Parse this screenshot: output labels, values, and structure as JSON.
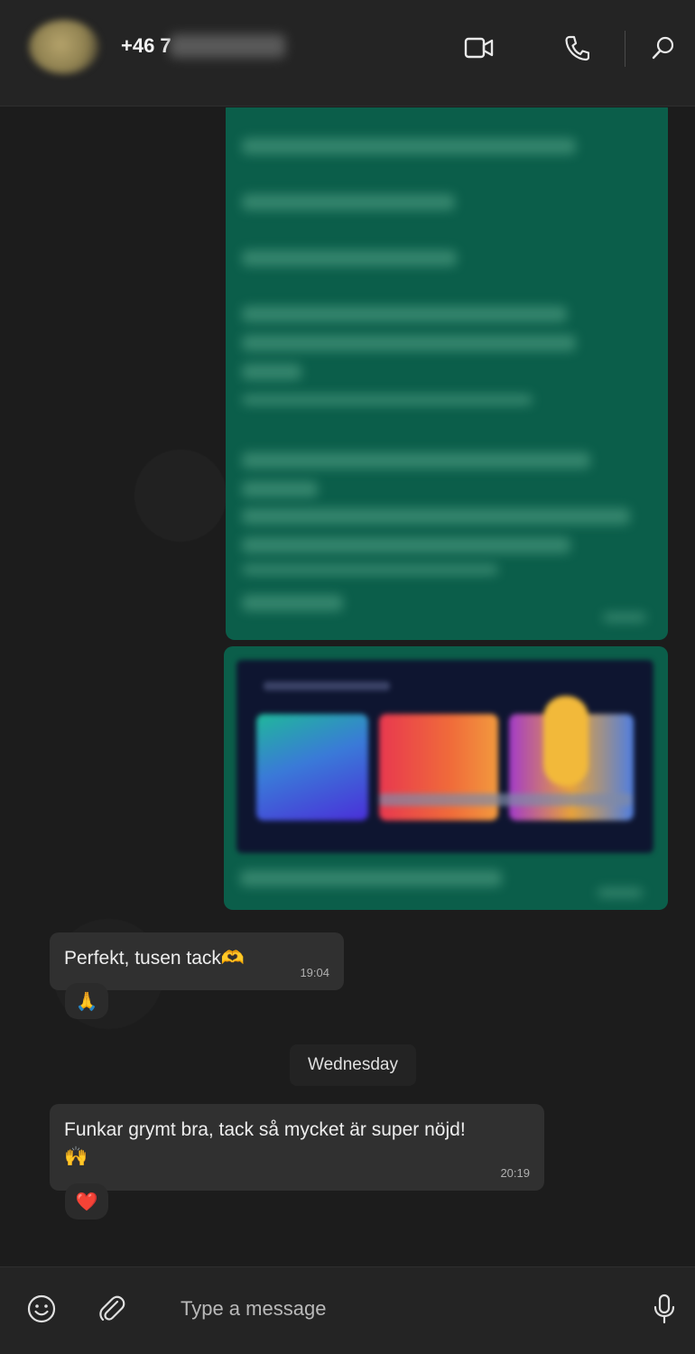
{
  "header": {
    "contact_visible": "+46 7",
    "icons": [
      "video-call-icon",
      "voice-call-icon",
      "search-icon"
    ]
  },
  "messages": [
    {
      "direction": "incoming",
      "text": "Perfekt, tusen tack🫶",
      "time": "19:04",
      "reaction": "🙏"
    },
    {
      "direction": "incoming",
      "text": "Funkar grymt bra, tack så mycket är super nöjd!\n🙌",
      "time": "20:19",
      "reaction": "❤️"
    }
  ],
  "day_separator": "Wednesday",
  "composer": {
    "placeholder": "Type a message",
    "icons": [
      "emoji-icon",
      "attach-icon",
      "microphone-icon"
    ]
  },
  "colors": {
    "outgoing_bubble": "#0b5e4a",
    "incoming_bubble": "#303030",
    "background": "#1c1c1c",
    "header": "#242424"
  }
}
